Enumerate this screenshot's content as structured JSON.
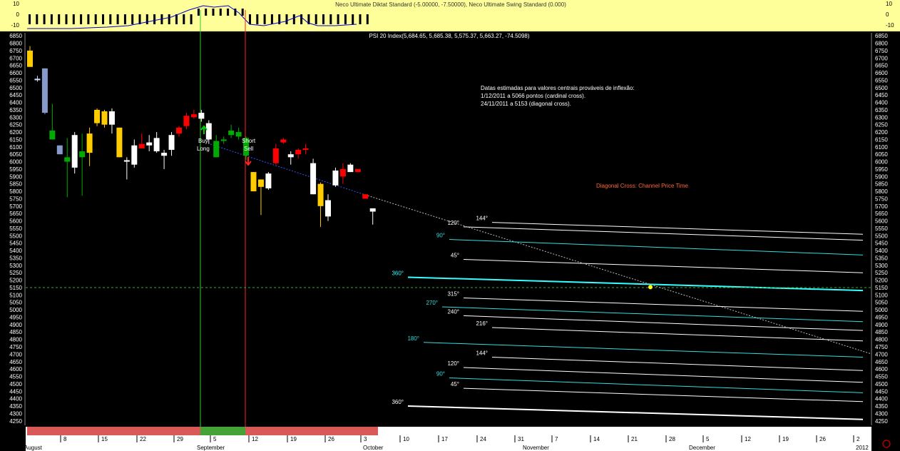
{
  "indicator": {
    "title": "Neco Ultimate Diktat Standard (-5.00000, -7.50000), Neco Ultimate Swing Standard (0.000)",
    "ticks": [
      "10",
      "0",
      "-10"
    ],
    "bg_color": "#ffff99"
  },
  "chart_data": {
    "type": "candlestick",
    "title": "PSI 20 Index(5,684.65, 5,685.38, 5,575.37, 5,663.27, -74.5098)",
    "ylim": [
      4220,
      6870
    ],
    "y_ticks": [
      6850,
      6800,
      6750,
      6700,
      6650,
      6600,
      6550,
      6500,
      6450,
      6400,
      6350,
      6300,
      6250,
      6200,
      6150,
      6100,
      6050,
      6000,
      5950,
      5900,
      5850,
      5800,
      5750,
      5700,
      5650,
      5600,
      5550,
      5500,
      5450,
      5400,
      5350,
      5300,
      5250,
      5200,
      5150,
      5100,
      5050,
      5000,
      4950,
      4900,
      4850,
      4800,
      4750,
      4700,
      4650,
      4600,
      4550,
      4500,
      4450,
      4400,
      4350,
      4300,
      4250
    ],
    "x_day_labels": [
      "8",
      "15",
      "22",
      "29",
      "5",
      "12",
      "19",
      "26",
      "3",
      "10",
      "17",
      "24",
      "31",
      "7",
      "14",
      "21",
      "28",
      "5",
      "12",
      "19",
      "26",
      "2"
    ],
    "x_month_labels": [
      "August",
      "September",
      "October",
      "November",
      "December",
      "2012"
    ],
    "candles": [
      {
        "o": 6750,
        "h": 6780,
        "l": 6640,
        "c": 6640,
        "color": "#ffcc00"
      },
      {
        "o": 6560,
        "h": 6580,
        "l": 6540,
        "c": 6550,
        "color": "#ccddff"
      },
      {
        "o": 6630,
        "h": 6630,
        "l": 6320,
        "c": 6330,
        "color": "#8899cc"
      },
      {
        "o": 6210,
        "h": 6390,
        "l": 6150,
        "c": 6150,
        "color": "#00aa00"
      },
      {
        "o": 6110,
        "h": 6110,
        "l": 6050,
        "c": 6050,
        "color": "#8899cc"
      },
      {
        "o": 6030,
        "h": 6160,
        "l": 5760,
        "c": 6000,
        "color": "#00aa00"
      },
      {
        "o": 5960,
        "h": 6200,
        "l": 5920,
        "c": 6180,
        "color": "#ffffff"
      },
      {
        "o": 6030,
        "h": 6190,
        "l": 5770,
        "c": 6070,
        "color": "#00aa00"
      },
      {
        "o": 6060,
        "h": 6230,
        "l": 5970,
        "c": 6190,
        "color": "#ffcc00"
      },
      {
        "o": 6260,
        "h": 6360,
        "l": 6240,
        "c": 6350,
        "color": "#ffcc00"
      },
      {
        "o": 6340,
        "h": 6350,
        "l": 6230,
        "c": 6250,
        "color": "#ffcc00"
      },
      {
        "o": 6340,
        "h": 6360,
        "l": 6190,
        "c": 6250,
        "color": "#ffffff"
      },
      {
        "o": 6230,
        "h": 6230,
        "l": 6030,
        "c": 6030,
        "color": "#ffcc00"
      },
      {
        "o": 6000,
        "h": 6030,
        "l": 5880,
        "c": 6010,
        "color": "#ffffff"
      },
      {
        "o": 5980,
        "h": 6150,
        "l": 5960,
        "c": 6110,
        "color": "#ffffff"
      },
      {
        "o": 6120,
        "h": 6190,
        "l": 6090,
        "c": 6090,
        "color": "#ff0000"
      },
      {
        "o": 6110,
        "h": 6180,
        "l": 6070,
        "c": 6130,
        "color": "#ffffff"
      },
      {
        "o": 6160,
        "h": 6200,
        "l": 6060,
        "c": 6070,
        "color": "#ffffff"
      },
      {
        "o": 6060,
        "h": 6080,
        "l": 5950,
        "c": 6040,
        "color": "#ffffff"
      },
      {
        "o": 6080,
        "h": 6200,
        "l": 6040,
        "c": 6180,
        "color": "#ffffff"
      },
      {
        "o": 6190,
        "h": 6240,
        "l": 6170,
        "c": 6230,
        "color": "#ff0000"
      },
      {
        "o": 6240,
        "h": 6330,
        "l": 6220,
        "c": 6310,
        "color": "#ff0000"
      },
      {
        "o": 6300,
        "h": 6350,
        "l": 6290,
        "c": 6320,
        "color": "#ff0000"
      },
      {
        "o": 6290,
        "h": 6350,
        "l": 6270,
        "c": 6330,
        "color": "#ffffff"
      },
      {
        "o": 6260,
        "h": 6280,
        "l": 6120,
        "c": 6150,
        "color": "#ffffff"
      },
      {
        "o": 6140,
        "h": 6180,
        "l": 6030,
        "c": 6030,
        "color": "#00aa00"
      },
      {
        "o": 6140,
        "h": 6170,
        "l": 6120,
        "c": 6150,
        "color": "#00aa00"
      },
      {
        "o": 6180,
        "h": 6250,
        "l": 6160,
        "c": 6210,
        "color": "#00aa00"
      },
      {
        "o": 6170,
        "h": 6230,
        "l": 6150,
        "c": 6200,
        "color": "#00aa00"
      },
      {
        "o": 6160,
        "h": 6170,
        "l": 6010,
        "c": 6040,
        "color": "#00aa00"
      },
      {
        "o": 5930,
        "h": 5930,
        "l": 5800,
        "c": 5800,
        "color": "#ffcc00"
      },
      {
        "o": 5880,
        "h": 5880,
        "l": 5640,
        "c": 5830,
        "color": "#ffcc00"
      },
      {
        "o": 5820,
        "h": 5930,
        "l": 5810,
        "c": 5920,
        "color": "#ffffff"
      },
      {
        "o": 5990,
        "h": 6120,
        "l": 5980,
        "c": 6090,
        "color": "#ff0000"
      },
      {
        "o": 6130,
        "h": 6160,
        "l": 6120,
        "c": 6150,
        "color": "#ff0000"
      },
      {
        "o": 6050,
        "h": 6070,
        "l": 5980,
        "c": 6030,
        "color": "#ffffff"
      },
      {
        "o": 6050,
        "h": 6090,
        "l": 6020,
        "c": 6080,
        "color": "#ff0000"
      },
      {
        "o": 6080,
        "h": 6120,
        "l": 6050,
        "c": 6090,
        "color": "#ff0000"
      },
      {
        "o": 5780,
        "h": 6020,
        "l": 5780,
        "c": 5990,
        "color": "#ffffff"
      },
      {
        "o": 5850,
        "h": 5860,
        "l": 5560,
        "c": 5700,
        "color": "#ffcc00"
      },
      {
        "o": 5630,
        "h": 5780,
        "l": 5600,
        "c": 5740,
        "color": "#ffffff"
      },
      {
        "o": 5840,
        "h": 5960,
        "l": 5830,
        "c": 5940,
        "color": "#ffffff"
      },
      {
        "o": 5900,
        "h": 5990,
        "l": 5850,
        "c": 5950,
        "color": "#ff0000"
      },
      {
        "o": 5930,
        "h": 5990,
        "l": 5930,
        "c": 5980,
        "color": "#ffffff"
      },
      {
        "o": 5950,
        "h": 5950,
        "l": 5930,
        "c": 5930,
        "color": "#ff0000"
      },
      {
        "o": 5780,
        "h": 5780,
        "l": 5750,
        "c": 5750,
        "color": "#ff0000"
      },
      {
        "o": 5685,
        "h": 5685,
        "l": 5575,
        "c": 5663,
        "color": "#ffffff"
      }
    ],
    "annotations": {
      "buy": {
        "line1": "Buy",
        "line2": "Long"
      },
      "sell": {
        "line1": "Short",
        "line2": "Sell"
      },
      "note_lines": [
        "Datas estimadas para valores centrais prováveis de inflexão:",
        "1/12/2011 a 5066 pontos (cardinal cross).",
        "24/11/2011 a 5153 (diagonal cross)."
      ],
      "diagonal_label": "Diagonal Cross: Channel Price Time"
    },
    "angle_lines": [
      {
        "label": "144°",
        "y1": 5590,
        "y2": 5510,
        "color": "#ffffff"
      },
      {
        "label": "120°",
        "y1": 5560,
        "y2": 5470,
        "color": "#ffffff"
      },
      {
        "label": "90°",
        "y1": 5475,
        "y2": 5370,
        "color": "#33dddd"
      },
      {
        "label": "45°",
        "y1": 5340,
        "y2": 5250,
        "color": "#ffffff"
      },
      {
        "label": "360°",
        "y1": 5220,
        "y2": 5130,
        "color": "#33ffff"
      },
      {
        "label": "315°",
        "y1": 5080,
        "y2": 4990,
        "color": "#ffffff"
      },
      {
        "label": "270°",
        "y1": 5020,
        "y2": 4920,
        "color": "#33dddd"
      },
      {
        "label": "240°",
        "y1": 4960,
        "y2": 4860,
        "color": "#ffffff"
      },
      {
        "label": "216°",
        "y1": 4880,
        "y2": 4790,
        "color": "#ffffff"
      },
      {
        "label": "180°",
        "y1": 4780,
        "y2": 4680,
        "color": "#33dddd"
      },
      {
        "label": "144°",
        "y1": 4680,
        "y2": 4590,
        "color": "#ffffff"
      },
      {
        "label": "120°",
        "y1": 4610,
        "y2": 4510,
        "color": "#ffffff"
      },
      {
        "label": "90°",
        "y1": 4540,
        "y2": 4440,
        "color": "#33dddd"
      },
      {
        "label": "45°",
        "y1": 4470,
        "y2": 4380,
        "color": "#ffffff"
      },
      {
        "label": "360°",
        "y1": 4350,
        "y2": 4260,
        "color": "#ffffff"
      }
    ],
    "horizontal_ref": 5150,
    "cross_point_value": 5153
  }
}
